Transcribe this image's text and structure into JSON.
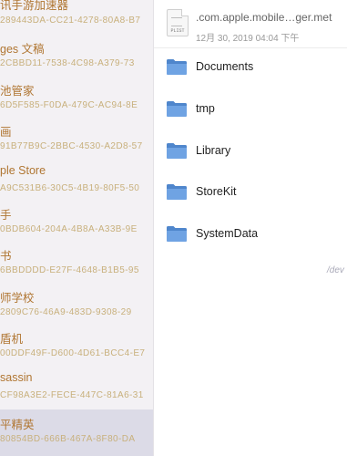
{
  "app_list": [
    {
      "name": "讯手游加速器",
      "uuid": "289443DA-CC21-4278-80A8-B7",
      "selected": false
    },
    {
      "name": "ges 文稿",
      "uuid": "2CBBD11-7538-4C98-A379-73",
      "selected": false
    },
    {
      "name": "池管家",
      "uuid": "6D5F585-F0DA-479C-AC94-8E",
      "selected": false
    },
    {
      "name": "画",
      "uuid": "91B77B9C-2BBC-4530-A2D8-57",
      "selected": false
    },
    {
      "name": "ple Store",
      "uuid": "A9C531B6-30C5-4B19-80F5-50",
      "selected": false
    },
    {
      "name": "手",
      "uuid": "0BDB604-204A-4B8A-A33B-9E",
      "selected": false
    },
    {
      "name": "书",
      "uuid": "6BBDDDD-E27F-4648-B1B5-95",
      "selected": false
    },
    {
      "name": "师学校",
      "uuid": "2809C76-46A9-483D-9308-29",
      "selected": false
    },
    {
      "name": "盾机",
      "uuid": "00DDF49F-D600-4D61-BCC4-E7",
      "selected": false
    },
    {
      "name": "sassin",
      "uuid": "CF98A3E2-FECE-447C-81A6-31",
      "selected": false
    },
    {
      "name": "平精英",
      "uuid": "80854BD-666B-467A-8F80-DA",
      "selected": true
    }
  ],
  "plist_file": {
    "name": ".com.apple.mobile…ger.met",
    "date": "12月 30, 2019 04:04 下午",
    "icon_tag": "PLIST",
    "icon": "plist-file-icon"
  },
  "folders": [
    {
      "label": "Documents",
      "icon": "folder-icon"
    },
    {
      "label": "tmp",
      "icon": "folder-icon"
    },
    {
      "label": "Library",
      "icon": "folder-icon"
    },
    {
      "label": "StoreKit",
      "icon": "folder-icon"
    },
    {
      "label": "SystemData",
      "icon": "folder-icon"
    }
  ],
  "path_text": "/dev",
  "colors": {
    "app_name": "#b07632",
    "app_uuid": "#c8b07c",
    "selected_row": "#dcdbe7",
    "folder_blue": "#5b93d6"
  }
}
